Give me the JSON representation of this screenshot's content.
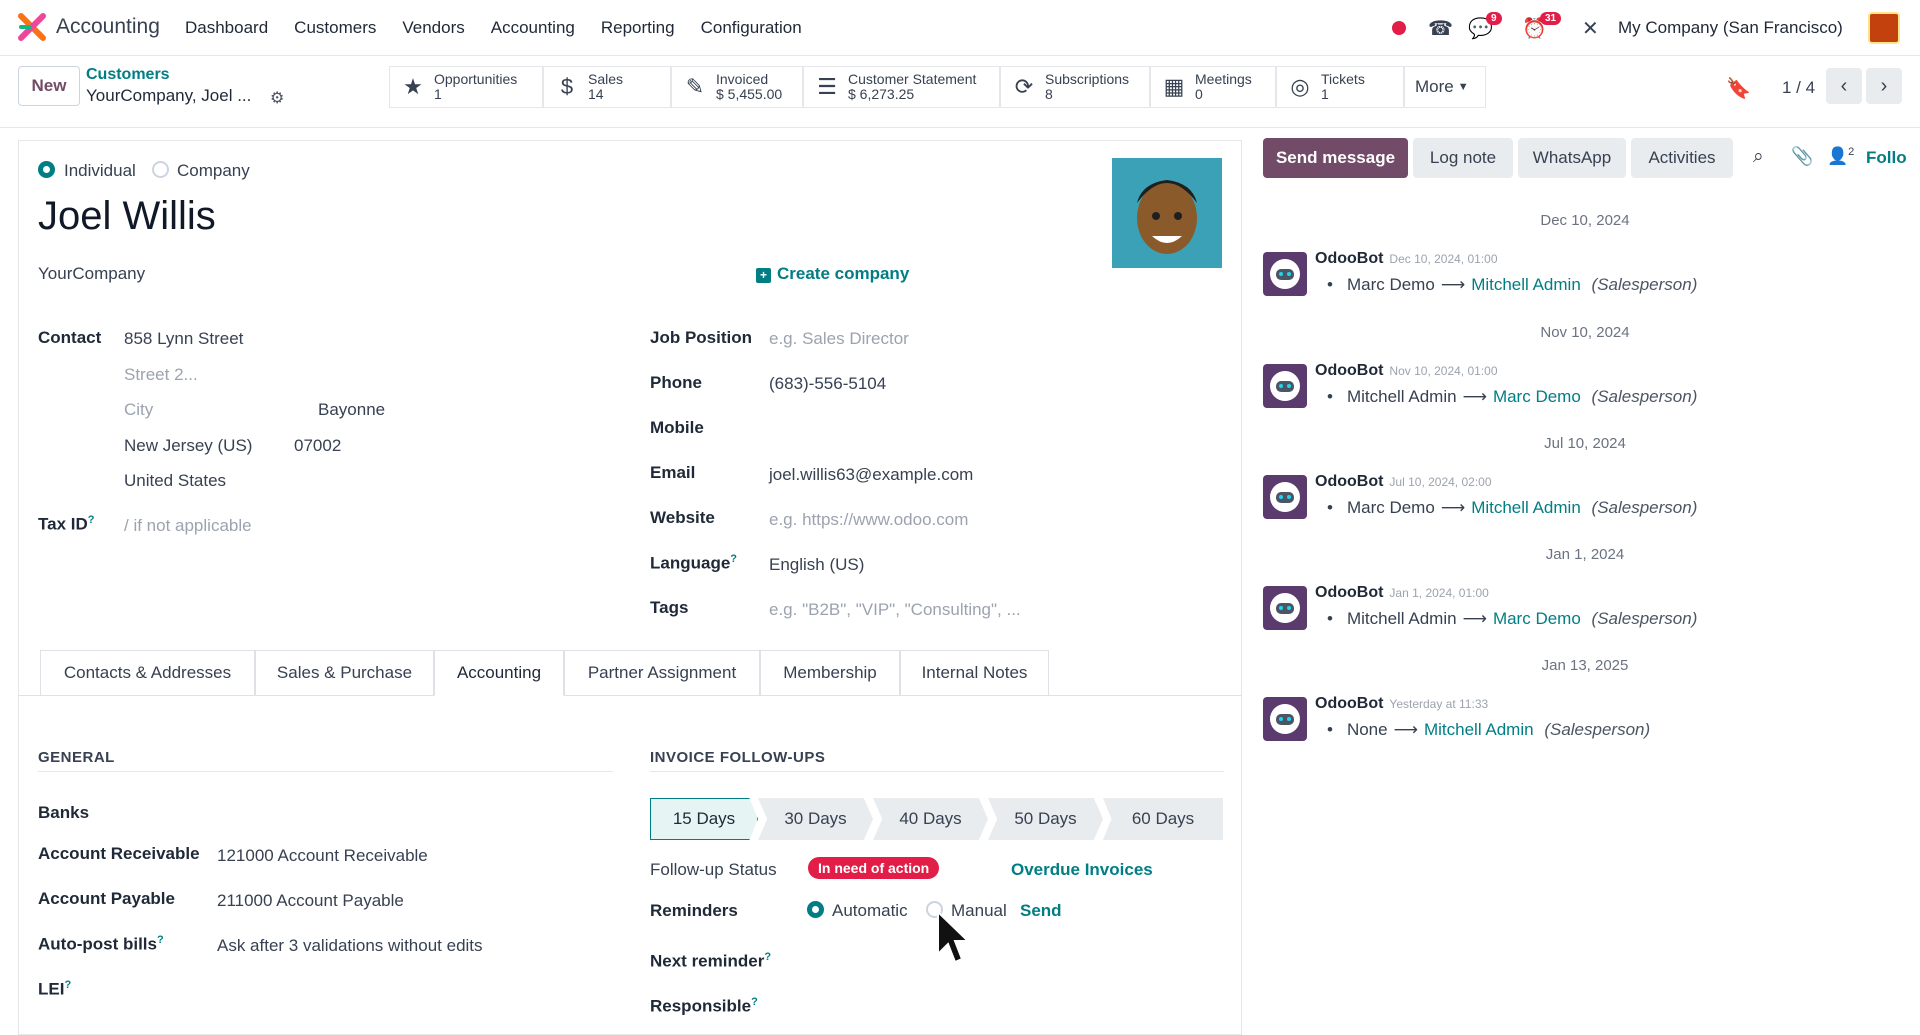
{
  "nav": {
    "app_name": "Accounting",
    "menu": [
      "Dashboard",
      "Customers",
      "Vendors",
      "Accounting",
      "Reporting",
      "Configuration"
    ],
    "messages_badge": "9",
    "activities_badge": "31",
    "company": "My Company (San Francisco)"
  },
  "control_panel": {
    "new_label": "New",
    "breadcrumb_parent": "Customers",
    "breadcrumb_current": "YourCompany, Joel ...",
    "smart_buttons": [
      {
        "icon": "star-icon",
        "label": "Opportunities",
        "value": "1"
      },
      {
        "icon": "dollar-icon",
        "label": "Sales",
        "value": "14"
      },
      {
        "icon": "edit-icon",
        "label": "Invoiced",
        "value": "$ 5,455.00"
      },
      {
        "icon": "list-icon",
        "label": "Customer Statement",
        "value": "$ 6,273.25"
      },
      {
        "icon": "refresh-icon",
        "label": "Subscriptions",
        "value": "8"
      },
      {
        "icon": "calendar-icon",
        "label": "Meetings",
        "value": "0"
      },
      {
        "icon": "lifebuoy-icon",
        "label": "Tickets",
        "value": "1"
      }
    ],
    "more_label": "More",
    "pager": "1 / 4"
  },
  "form": {
    "type_individual": "Individual",
    "type_company": "Company",
    "name": "Joel Willis",
    "parent_company": "YourCompany",
    "create_company": "Create company",
    "contact_label": "Contact",
    "street": "858 Lynn Street",
    "street2_placeholder": "Street 2...",
    "city_placeholder": "City",
    "city_value": "Bayonne",
    "state": "New Jersey (US)",
    "zip": "07002",
    "country": "United States",
    "taxid_label": "Tax ID",
    "taxid_placeholder": "/ if not applicable",
    "job_position_label": "Job Position",
    "job_position_placeholder": "e.g. Sales Director",
    "phone_label": "Phone",
    "phone": "(683)-556-5104",
    "mobile_label": "Mobile",
    "email_label": "Email",
    "email": "joel.willis63@example.com",
    "website_label": "Website",
    "website_placeholder": "e.g. https://www.odoo.com",
    "language_label": "Language",
    "language": "English (US)",
    "tags_label": "Tags",
    "tags_placeholder": "e.g. \"B2B\", \"VIP\", \"Consulting\", ...",
    "help_mark": "?"
  },
  "tabs": [
    "Contacts & Addresses",
    "Sales & Purchase",
    "Accounting",
    "Partner Assignment",
    "Membership",
    "Internal Notes"
  ],
  "active_tab": "Accounting",
  "accounting": {
    "general_title": "GENERAL",
    "banks_label": "Banks",
    "receivable_label": "Account Receivable",
    "receivable_value": "121000 Account Receivable",
    "payable_label": "Account Payable",
    "payable_value": "211000 Account Payable",
    "autopost_label": "Auto-post bills",
    "autopost_value": "Ask after 3 validations without edits",
    "lei_label": "LEI",
    "followups_title": "INVOICE FOLLOW-UPS",
    "steps": [
      "15 Days",
      "30 Days",
      "40 Days",
      "50 Days",
      "60 Days"
    ],
    "followup_status_label": "Follow-up Status",
    "followup_status_badge": "In need of action",
    "overdue_link": "Overdue Invoices",
    "reminders_label": "Reminders",
    "reminder_automatic": "Automatic",
    "reminder_manual": "Manual",
    "reminder_send": "Send",
    "next_reminder_label": "Next reminder",
    "responsible_label": "Responsible"
  },
  "chatter": {
    "send_message": "Send message",
    "log_note": "Log note",
    "whatsapp": "WhatsApp",
    "activities": "Activities",
    "followers_count": "2",
    "follow_label": "Follo",
    "messages": [
      {
        "sep": "Dec 10, 2024",
        "author": "OdooBot",
        "date": "Dec 10, 2024, 01:00",
        "from": "Marc Demo",
        "to": "Mitchell Admin",
        "field": "(Salesperson)"
      },
      {
        "sep": "Nov 10, 2024",
        "author": "OdooBot",
        "date": "Nov 10, 2024, 01:00",
        "from": "Mitchell Admin",
        "to": "Marc Demo",
        "field": "(Salesperson)"
      },
      {
        "sep": "Jul 10, 2024",
        "author": "OdooBot",
        "date": "Jul 10, 2024, 02:00",
        "from": "Marc Demo",
        "to": "Mitchell Admin",
        "field": "(Salesperson)"
      },
      {
        "sep": "Jan 1, 2024",
        "author": "OdooBot",
        "date": "Jan 1, 2024, 01:00",
        "from": "Mitchell Admin",
        "to": "Marc Demo",
        "field": "(Salesperson)"
      },
      {
        "sep": "Jan 13, 2025",
        "author": "OdooBot",
        "date": "Yesterday at 11:33",
        "from": "None",
        "to": "Mitchell Admin",
        "field": "(Salesperson)"
      }
    ]
  },
  "colors": {
    "brand": "#714b67",
    "teal": "#017e84",
    "danger": "#e11d48"
  }
}
